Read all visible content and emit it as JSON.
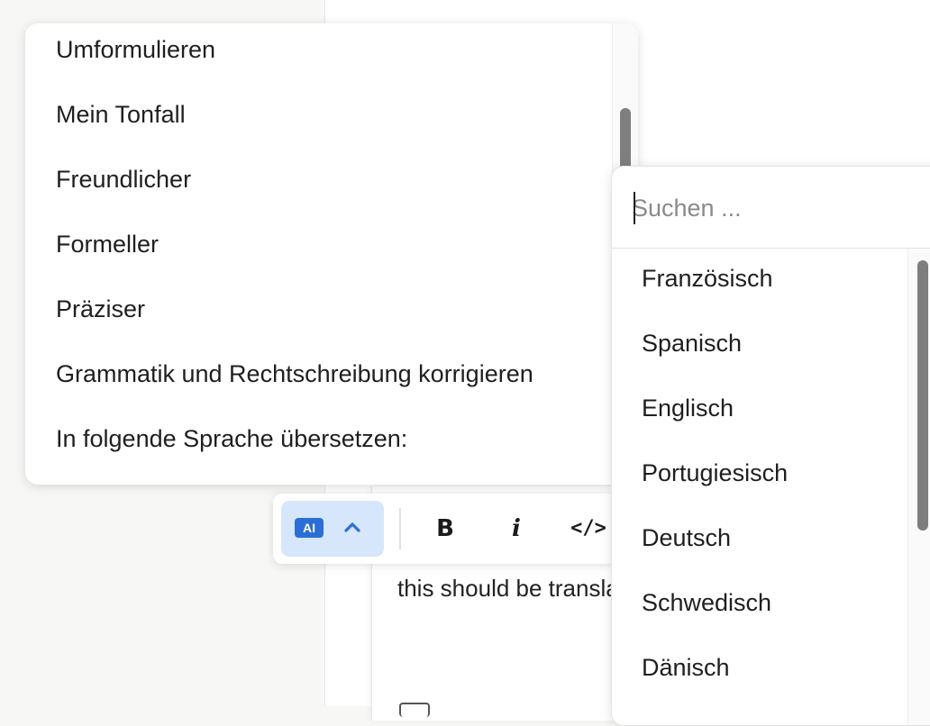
{
  "ai_menu": {
    "items": [
      {
        "label": "Umformulieren"
      },
      {
        "label": "Mein Tonfall"
      },
      {
        "label": "Freundlicher"
      },
      {
        "label": "Formeller"
      },
      {
        "label": "Präziser"
      },
      {
        "label": "Grammatik und Rechtschreibung korrigieren"
      },
      {
        "label": "In folgende Sprache übersetzen:"
      }
    ]
  },
  "toolbar": {
    "ai_badge_label": "AI",
    "bold_label": "B",
    "italic_label": "i",
    "code_label": "</>"
  },
  "editor": {
    "text": "this should be translated"
  },
  "language_dropdown": {
    "search_placeholder": "Suchen ...",
    "search_value": "",
    "languages": [
      {
        "label": "Französisch"
      },
      {
        "label": "Spanisch"
      },
      {
        "label": "Englisch"
      },
      {
        "label": "Portugiesisch"
      },
      {
        "label": "Deutsch"
      },
      {
        "label": "Schwedisch"
      },
      {
        "label": "Dänisch"
      }
    ]
  },
  "colors": {
    "accent": "#2b6fd6",
    "accent_bg": "#d6e6fb"
  },
  "icons": {
    "ai_toggle_chevron": "chevron-up-icon"
  }
}
